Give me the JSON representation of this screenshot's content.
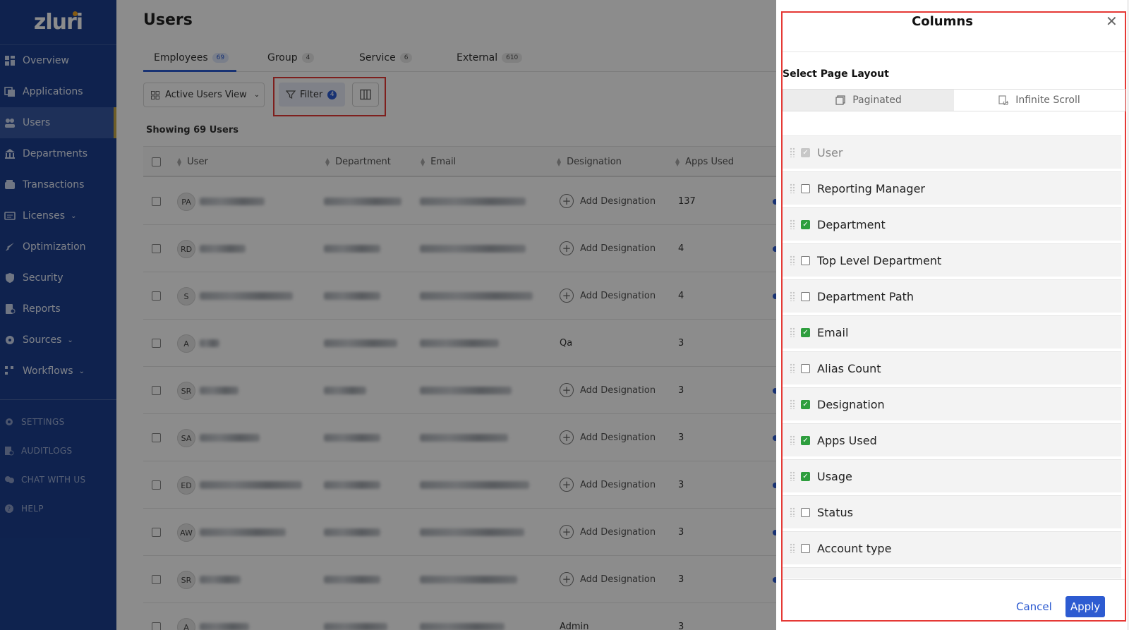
{
  "app": {
    "logo": "zluri"
  },
  "sidebar": {
    "items": [
      {
        "label": "Overview",
        "icon": "dashboard-icon"
      },
      {
        "label": "Applications",
        "icon": "apps-icon"
      },
      {
        "label": "Users",
        "icon": "users-icon",
        "active": true
      },
      {
        "label": "Departments",
        "icon": "building-icon"
      },
      {
        "label": "Transactions",
        "icon": "wallet-icon"
      },
      {
        "label": "Licenses",
        "icon": "license-icon",
        "chevron": true
      },
      {
        "label": "Optimization",
        "icon": "rocket-icon"
      },
      {
        "label": "Security",
        "icon": "shield-icon"
      },
      {
        "label": "Reports",
        "icon": "report-icon"
      },
      {
        "label": "Sources",
        "icon": "sources-icon",
        "chevron": true
      },
      {
        "label": "Workflows",
        "icon": "workflow-icon",
        "chevron": true
      }
    ],
    "secondary": [
      {
        "label": "SETTINGS",
        "icon": "gear-icon"
      },
      {
        "label": "AUDITLOGS",
        "icon": "audit-icon"
      },
      {
        "label": "CHAT WITH US",
        "icon": "chat-icon"
      },
      {
        "label": "HELP",
        "icon": "help-icon"
      }
    ]
  },
  "main": {
    "title": "Users",
    "tabs": [
      {
        "label": "Employees",
        "count": "69",
        "active": true
      },
      {
        "label": "Group",
        "count": "4"
      },
      {
        "label": "Service",
        "count": "6"
      },
      {
        "label": "External",
        "count": "610"
      }
    ],
    "view_button": "Active Users View",
    "filter_button": "Filter",
    "filter_count": "4",
    "showing": "Showing 69 Users",
    "columns": [
      "User",
      "Department",
      "Email",
      "Designation",
      "Apps Used"
    ],
    "rows": [
      {
        "initials": "PA",
        "designation": "",
        "add_designation": "Add Designation",
        "apps": "137"
      },
      {
        "initials": "RD",
        "designation": "",
        "add_designation": "Add Designation",
        "apps": "4"
      },
      {
        "initials": "S",
        "designation": "",
        "add_designation": "Add Designation",
        "apps": "4"
      },
      {
        "initials": "A",
        "designation": "Qa",
        "add_designation": "",
        "apps": "3"
      },
      {
        "initials": "SR",
        "designation": "",
        "add_designation": "Add Designation",
        "apps": "3"
      },
      {
        "initials": "SA",
        "designation": "",
        "add_designation": "Add Designation",
        "apps": "3"
      },
      {
        "initials": "ED",
        "designation": "",
        "add_designation": "Add Designation",
        "apps": "3"
      },
      {
        "initials": "AW",
        "designation": "",
        "add_designation": "Add Designation",
        "apps": "3"
      },
      {
        "initials": "SR",
        "designation": "",
        "add_designation": "Add Designation",
        "apps": "3"
      },
      {
        "initials": "A",
        "designation": "Admin",
        "add_designation": "",
        "apps": "3"
      }
    ]
  },
  "panel": {
    "title": "Columns",
    "layout_label": "Select Page Layout",
    "layout_options": [
      {
        "label": "Paginated",
        "selected": true
      },
      {
        "label": "Infinite Scroll",
        "selected": false
      }
    ],
    "columns": [
      {
        "label": "User",
        "checked": true,
        "disabled": true
      },
      {
        "label": "Reporting Manager",
        "checked": false
      },
      {
        "label": "Department",
        "checked": true
      },
      {
        "label": "Top Level Department",
        "checked": false
      },
      {
        "label": "Department Path",
        "checked": false
      },
      {
        "label": "Email",
        "checked": true
      },
      {
        "label": "Alias Count",
        "checked": false
      },
      {
        "label": "Designation",
        "checked": true
      },
      {
        "label": "Apps Used",
        "checked": true
      },
      {
        "label": "Usage",
        "checked": true
      },
      {
        "label": "Status",
        "checked": false
      },
      {
        "label": "Account type",
        "checked": false
      }
    ],
    "cancel": "Cancel",
    "apply": "Apply"
  },
  "colors": {
    "sidebar": "#1c3f8f",
    "accent": "#2d5bd1",
    "check": "#2e9e3e",
    "highlight": "#e53935"
  }
}
